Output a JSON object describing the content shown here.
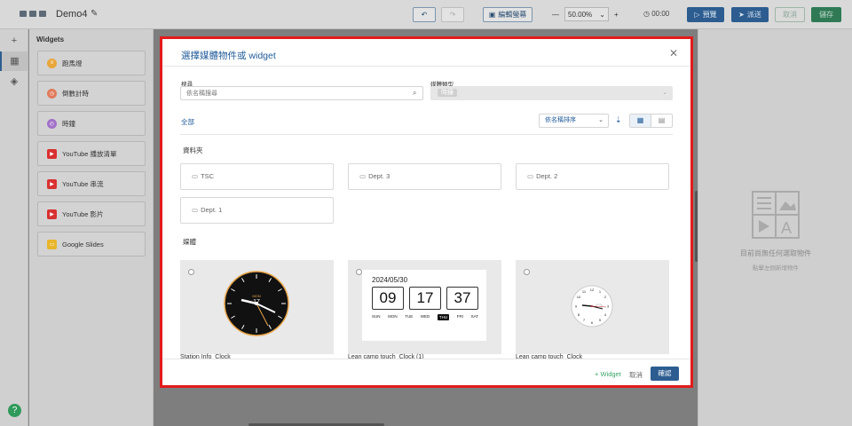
{
  "app": {
    "title": "Demo4"
  },
  "toolbar": {
    "edit_screen": "編輯螢幕",
    "zoom_minus": "—",
    "zoom_value": "50.00%",
    "zoom_plus": "+",
    "time": "00:00",
    "preview": "預覽",
    "publish": "派送",
    "cancel": "取消",
    "save": "儲存"
  },
  "widgets_panel": {
    "header": "Widgets",
    "items": [
      {
        "label": "跑馬燈",
        "color": "#e9a63a"
      },
      {
        "label": "倒數計時",
        "color": "#e07a5a"
      },
      {
        "label": "時鐘",
        "color": "#a070c8"
      },
      {
        "label": "YouTube 播放清單",
        "color": "#d93030"
      },
      {
        "label": "YouTube 串流",
        "color": "#d93030"
      },
      {
        "label": "YouTube 影片",
        "color": "#d93030"
      },
      {
        "label": "Google Slides",
        "color": "#e8b62a"
      }
    ]
  },
  "right_panel": {
    "empty_title": "目前尚無任何選取物件",
    "empty_hint": "點擊左側新增物件"
  },
  "modal": {
    "title": "選擇媒體物件或 widget",
    "search_label": "搜尋",
    "search_placeholder": "依名稱搜尋",
    "type_label": "媒體類型",
    "type_value": "時鐘",
    "all_link": "全部",
    "sort_value": "依名稱排序",
    "folders_header": "資料夾",
    "folders": [
      "TSC",
      "Dept. 3",
      "Dept. 2",
      "Dept. 1"
    ],
    "media_header": "媒體",
    "media": [
      {
        "name": "Station Info_Clock"
      },
      {
        "name": "Lean camp touch_Clock (1)"
      },
      {
        "name": "Lean camp touch_Clock"
      }
    ],
    "digital_clock": {
      "date": "2024/05/30",
      "hh": "09",
      "mm": "17",
      "ss": "37",
      "days": [
        "SUN",
        "MON",
        "TUE",
        "WED",
        "THU",
        "FRI",
        "SAT"
      ],
      "active_day": "THU"
    },
    "analog_clock": {
      "day_label": "MON",
      "day_num": "17"
    },
    "footer": {
      "add_widget": "+ Widget",
      "cancel": "取消",
      "confirm": "確認"
    }
  }
}
